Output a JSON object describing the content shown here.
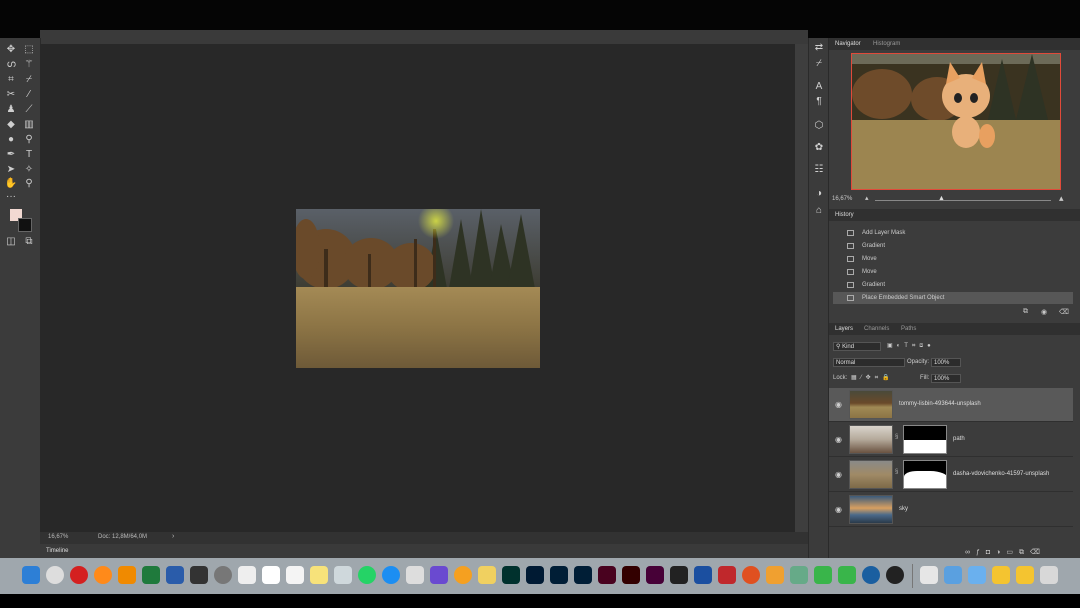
{
  "document_tabs": [
    "",
    "",
    ""
  ],
  "canvas": {
    "zoom": "16,67%",
    "doc_info": "Doc: 12,8M/64,0M",
    "timeline": "Timeline"
  },
  "navigator": {
    "tabs": [
      "Navigator",
      "Histogram"
    ],
    "zoom": "16,67%",
    "caption_line1": "",
    "caption_line2": ""
  },
  "history": {
    "tab": "History",
    "items": [
      "Add Layer Mask",
      "Gradient",
      "Move",
      "Move",
      "Gradient",
      "Place Embedded Smart Object"
    ]
  },
  "layers": {
    "tabs": [
      "Layers",
      "Channels",
      "Paths"
    ],
    "filter_label": "Kind",
    "blend_mode": "Normal",
    "opacity_label": "Opacity:",
    "opacity": "100%",
    "lock_label": "Lock:",
    "fill_label": "Fill:",
    "fill": "100%",
    "items": [
      {
        "name": "tommy-lisbin-493644-unsplash"
      },
      {
        "name": "path"
      },
      {
        "name": "dasha-vdovichenko-41597-unsplash"
      },
      {
        "name": "sky"
      }
    ]
  },
  "colors": {
    "foreground": "#f2d9d2",
    "background": "#111111",
    "accent": "#e04a3a"
  }
}
